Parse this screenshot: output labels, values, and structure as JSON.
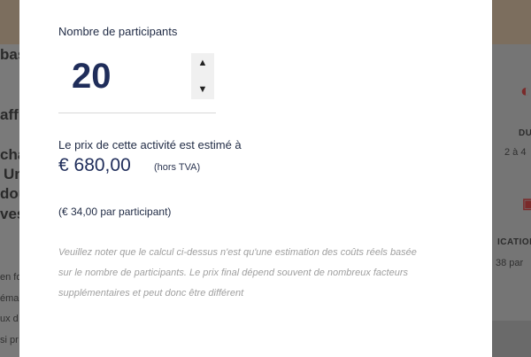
{
  "background": {
    "fragments_left": [
      "bas",
      "aff",
      "cha",
      "Un",
      "dou",
      "ves",
      "en fo",
      "éma",
      "ux d",
      "si pr"
    ],
    "fragments_right": [
      "DU",
      "2 à 4",
      "ICATION",
      "38 par"
    ]
  },
  "modal": {
    "participants_label": "Nombre de participants",
    "participants_value": "20",
    "spin_up": "▲",
    "spin_down": "▼",
    "estimate_label": "Le prix de cette activité est estimé à",
    "price": "€ 680,00",
    "price_note": "(hors TVA)",
    "per_participant": "(€ 34,00 par participant)",
    "disclaimer_lines": [
      "Veuillez noter que le calcul ci-dessus n'est qu'une estimation des coûts réels basée",
      "sur le nombre de participants. Le prix final dépend souvent de nombreux facteurs",
      "supplémentaires et peut donc être différent"
    ]
  },
  "colors": {
    "overlay": "#6f6f6f",
    "navy": "#1f2d5a",
    "disclaimer": "#a0a0a0"
  }
}
